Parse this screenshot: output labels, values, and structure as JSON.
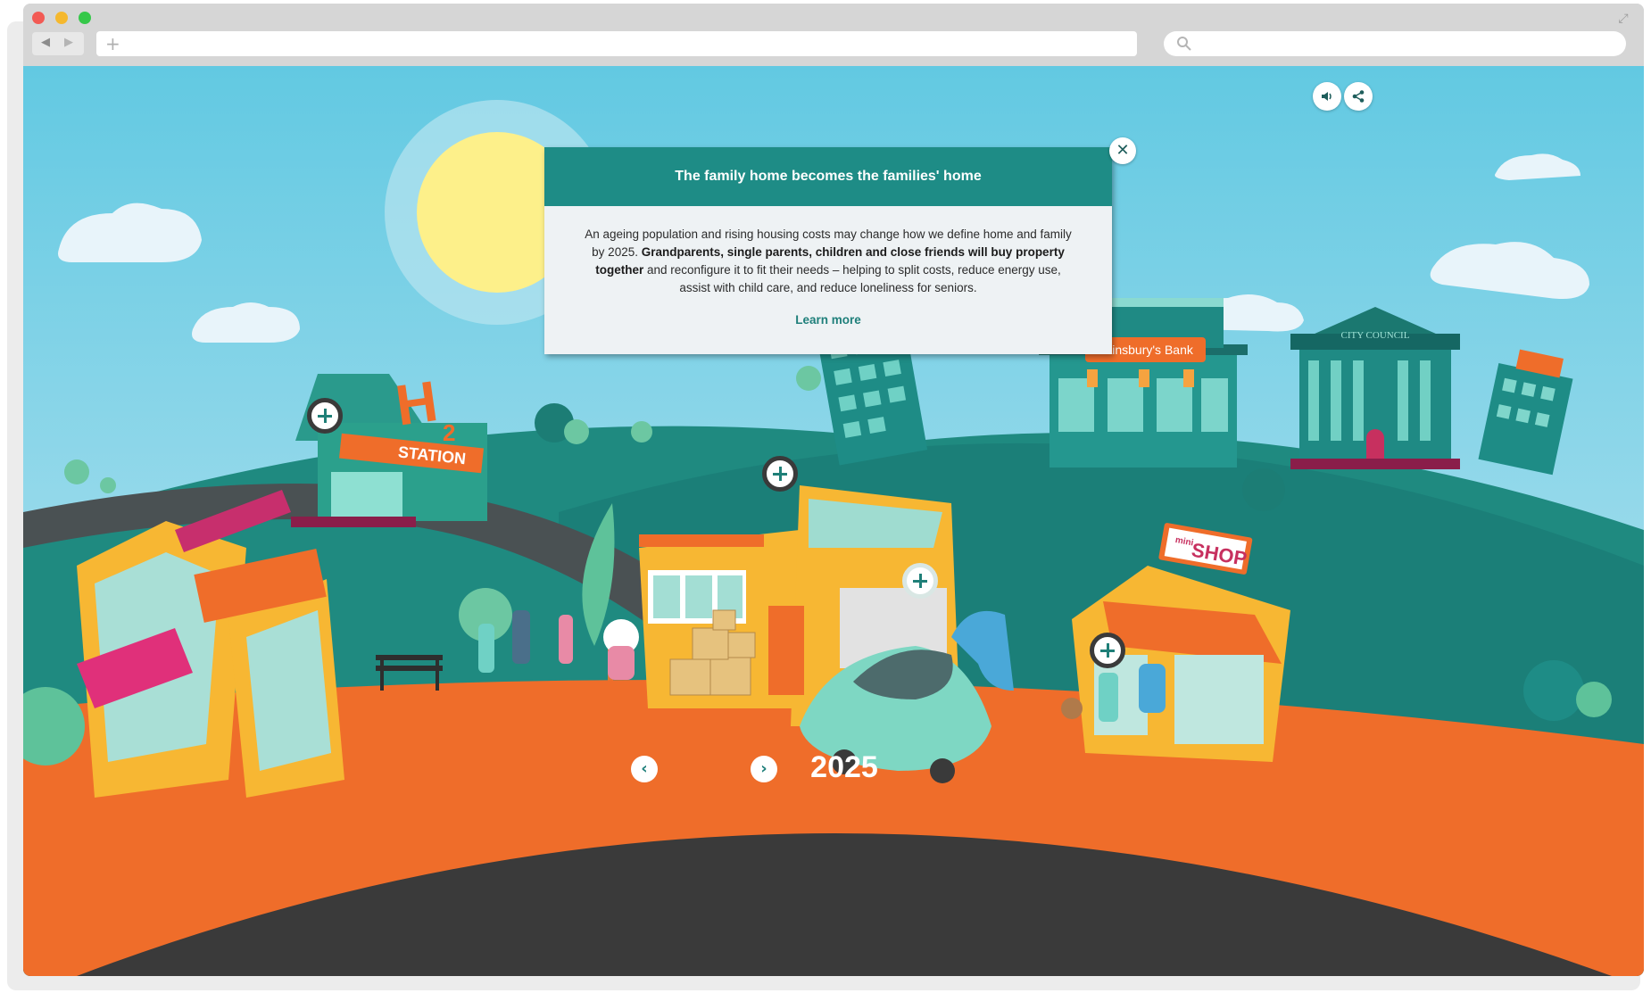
{
  "browser": {
    "back_icon": "◀",
    "forward_icon": "▶",
    "new_tab_icon": "+",
    "expand_icon": "⤢"
  },
  "popup": {
    "title": "The family home becomes the families' home",
    "body_before": "An ageing population and rising housing costs may change how we define home and family by 2025. ",
    "body_bold": "Grandparents, single parents, children and close friends will buy property together",
    "body_after": " and reconfigure it to fit their needs – helping to split costs, reduce energy use, assist with child care, and reduce loneliness for seniors.",
    "link": "Learn more",
    "close_icon": "✕"
  },
  "scene": {
    "station_sign": "STATION",
    "h2_sign": "H",
    "h2_sub": "2",
    "bank_sign": "Sainsbury's Bank",
    "council_sign": "CITY COUNCIL",
    "shop_sign_small": "mini",
    "shop_sign": "SHOP"
  },
  "timeline": {
    "year": "2025",
    "prev_icon": "‹",
    "next_icon": "›"
  },
  "colors": {
    "sky": "#6ccde3",
    "teal": "#1e8c86",
    "orange": "#ef6d2a",
    "road": "#3a3a3a"
  }
}
